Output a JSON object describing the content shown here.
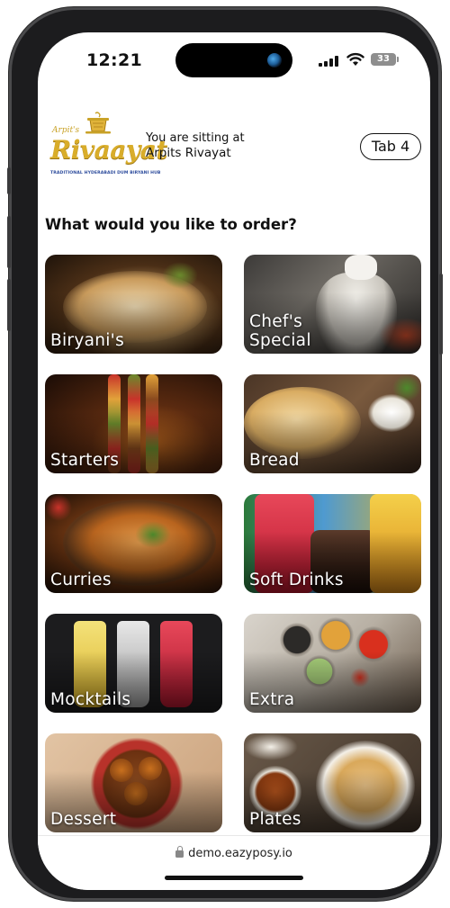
{
  "status_bar": {
    "time": "12:21",
    "battery": "33"
  },
  "header": {
    "logo": {
      "script_text": "Arpit's",
      "name": "Rivaayat",
      "tagline": "TRADITIONAL HYDERABADI DUM BIRYANI HUB"
    },
    "sitting_label": "You are sitting at",
    "restaurant_name": "Arpits Rivayat",
    "tab_label": "Tab 4"
  },
  "heading": "What would you like to order?",
  "categories": [
    {
      "label": "Biryani's"
    },
    {
      "label": "Chef's\nSpecial"
    },
    {
      "label": "Starters"
    },
    {
      "label": "Bread"
    },
    {
      "label": "Curries"
    },
    {
      "label": "Soft Drinks"
    },
    {
      "label": "Mocktails"
    },
    {
      "label": "Extra"
    },
    {
      "label": "Dessert"
    },
    {
      "label": "Plates"
    }
  ],
  "url_bar": {
    "url": "demo.eazyposy.io"
  },
  "colors": {
    "logo_gold": "#d9ad2a",
    "logo_tagline": "#2c4b9c",
    "text": "#111111"
  }
}
